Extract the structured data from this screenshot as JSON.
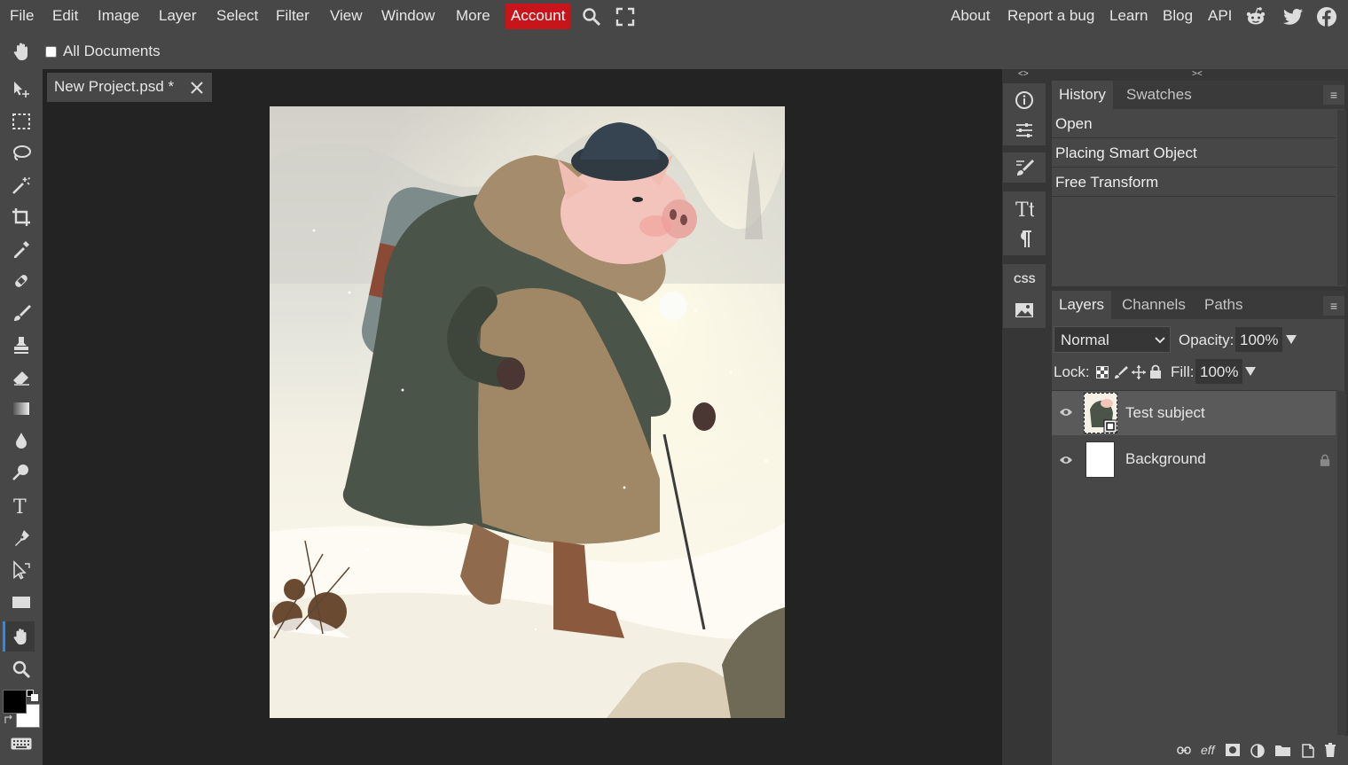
{
  "menu": {
    "file": "File",
    "edit": "Edit",
    "image": "Image",
    "layer": "Layer",
    "select": "Select",
    "filter": "Filter",
    "view": "View",
    "window": "Window",
    "more": "More",
    "account": "Account"
  },
  "links": {
    "about": "About",
    "report_bug": "Report a bug",
    "learn": "Learn",
    "blog": "Blog",
    "api": "API"
  },
  "options_bar": {
    "all_documents_label": "All Documents",
    "all_documents_checked": false
  },
  "document": {
    "tab_title": "New Project.psd *"
  },
  "history": {
    "tabs": [
      "History",
      "Swatches"
    ],
    "items": [
      "Open",
      "Placing Smart Object",
      "Free Transform"
    ]
  },
  "layers_panel": {
    "tabs": [
      "Layers",
      "Channels",
      "Paths"
    ],
    "blend_mode": "Normal",
    "opacity_label": "Opacity:",
    "opacity_value": "100%",
    "lock_label": "Lock:",
    "fill_label": "Fill:",
    "fill_value": "100%",
    "layers": [
      {
        "name": "Test subject",
        "selected": true,
        "visible": true,
        "locked": false
      },
      {
        "name": "Background",
        "selected": false,
        "visible": true,
        "locked": true
      }
    ]
  },
  "mini_panel": {
    "css_label": "CSS"
  },
  "colors": {
    "accent": "#2d8ceb",
    "account_red": "#c8151b",
    "foreground": "#000000",
    "background": "#ffffff"
  }
}
